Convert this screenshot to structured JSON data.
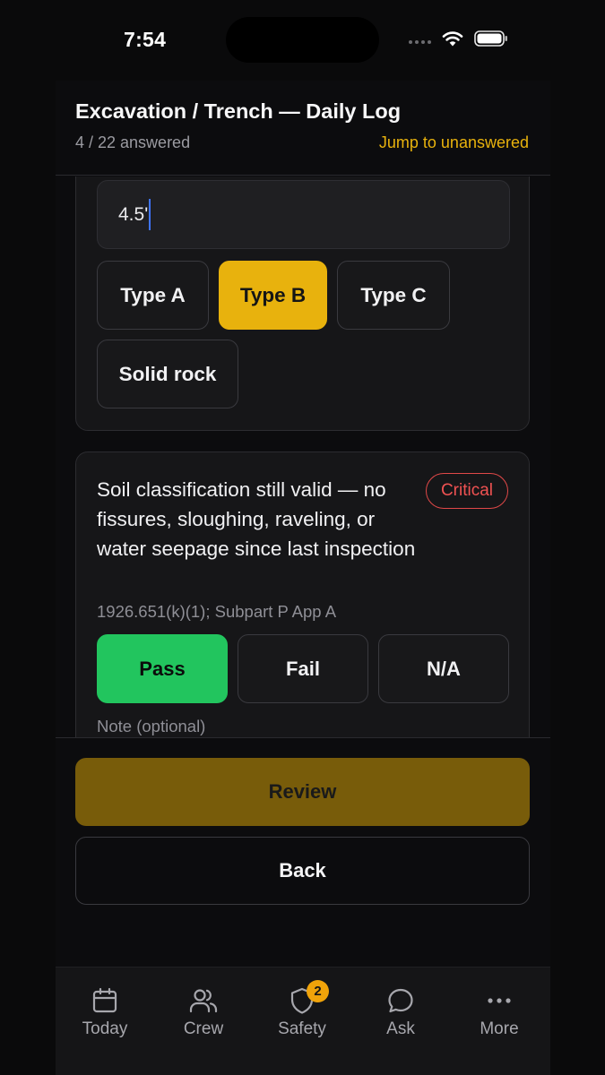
{
  "status_bar": {
    "time": "7:54"
  },
  "header": {
    "title": "Excavation / Trench — Daily Log",
    "progress": "4 / 22 answered",
    "jump_link": "Jump to unanswered"
  },
  "depth_question": {
    "value": "4.5'",
    "soil_options": [
      "Type A",
      "Type B",
      "Type C",
      "Solid rock"
    ],
    "selected_option": "Type B"
  },
  "soil_question": {
    "text": "Soil classification still valid — no fissures, sloughing, raveling, or water seepage since last inspection",
    "badge": "Critical",
    "reference": "1926.651(k)(1); Subpart P App A",
    "answers": [
      "Pass",
      "Fail",
      "N/A"
    ],
    "selected_answer": "Pass",
    "note_label": "Note (optional)"
  },
  "actions": {
    "review": "Review",
    "back": "Back"
  },
  "tabs": [
    {
      "label": "Today",
      "icon": "calendar-icon"
    },
    {
      "label": "Crew",
      "icon": "users-icon"
    },
    {
      "label": "Safety",
      "icon": "shield-icon",
      "badge": "2"
    },
    {
      "label": "Ask",
      "icon": "chat-bubble-icon"
    },
    {
      "label": "More",
      "icon": "more-dots-icon"
    }
  ],
  "colors": {
    "accent": "#e8b20d",
    "pass": "#22c55e",
    "critical": "#f05252",
    "review_button": "#785c0a",
    "badge": "#f0a30a"
  }
}
